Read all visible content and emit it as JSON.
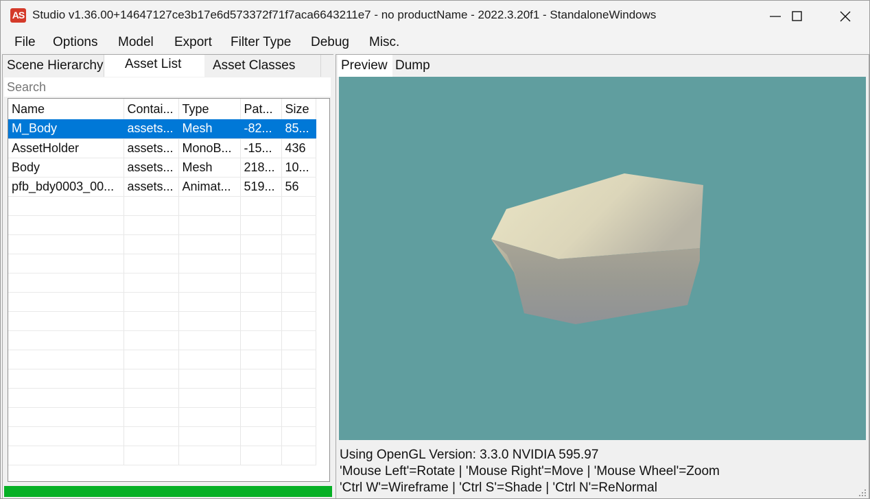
{
  "window": {
    "title": "Studio v1.36.00+14647127ce3b17e6d573372f71f7aca6643211e7 - no productName - 2022.3.20f1 - StandaloneWindows",
    "icon_text": "AS"
  },
  "menu": [
    "File",
    "Options",
    "Model",
    "Export",
    "Filter Type",
    "Debug",
    "Misc."
  ],
  "left_tabs": [
    "Scene Hierarchy",
    "Asset List",
    "Asset Classes"
  ],
  "active_left_tab": "Asset List",
  "search": {
    "placeholder": "Search"
  },
  "asset_list": {
    "columns": [
      "Name",
      "Contai...",
      "Type",
      "Pat...",
      "Size"
    ],
    "rows": [
      [
        "M_Body",
        "assets...",
        "Mesh",
        "-82...",
        "85..."
      ],
      [
        "AssetHolder",
        "assets...",
        "MonoB...",
        "-15...",
        "436"
      ],
      [
        "Body",
        "assets...",
        "Mesh",
        "218...",
        "10..."
      ],
      [
        "pfb_bdy0003_00...",
        "assets...",
        "Animat...",
        "519...",
        "56"
      ]
    ],
    "selected_row": 0
  },
  "progress": {
    "value": 1.0,
    "color": "#06b025"
  },
  "right_tabs": [
    "Preview",
    "Dump"
  ],
  "active_right_tab": "Preview",
  "preview": {
    "background": "#609e9f",
    "status_lines": [
      "Using OpenGL Version: 3.3.0 NVIDIA 595.97",
      "'Mouse Left'=Rotate | 'Mouse Right'=Move | 'Mouse Wheel'=Zoom",
      "'Ctrl W'=Wireframe | 'Ctrl S'=Shade | 'Ctrl N'=ReNormal"
    ]
  },
  "icons": {
    "minimize": "minimize-icon",
    "maximize": "maximize-icon",
    "close": "close-icon",
    "resize_grip": "resize-grip-icon"
  }
}
